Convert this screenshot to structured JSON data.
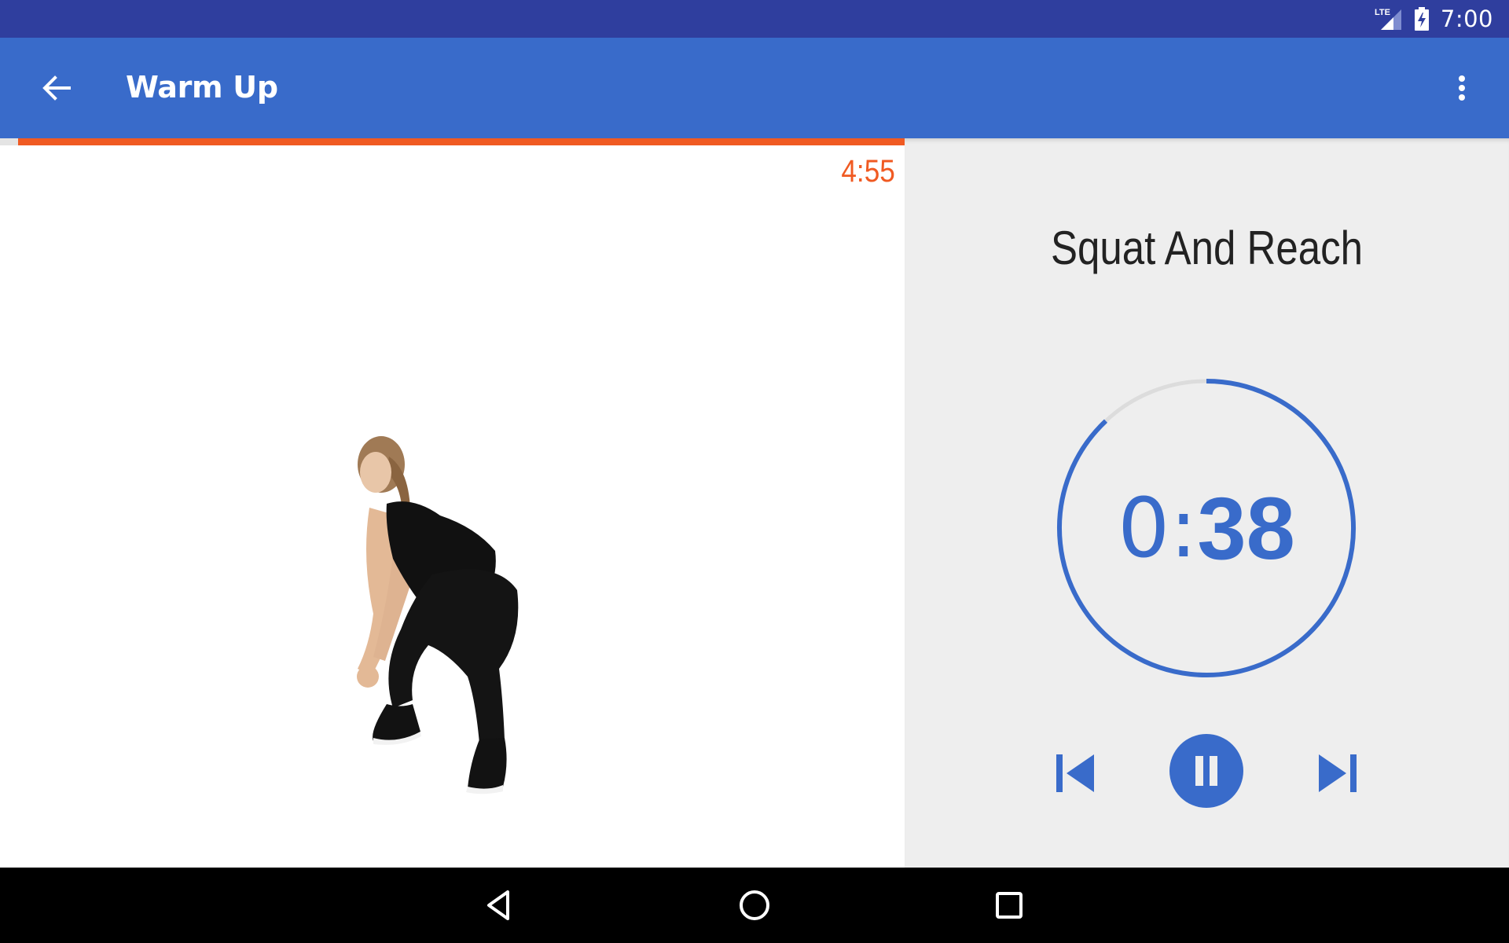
{
  "status_bar": {
    "network": "LTE",
    "time": "7:00",
    "icons": [
      "lte-signal-icon",
      "battery-charging-icon"
    ]
  },
  "app_bar": {
    "title": "Warm Up",
    "back_icon": "arrow-back-icon",
    "overflow_icon": "more-vert-icon"
  },
  "video": {
    "remaining_time": "4:55",
    "workout_progress_remaining_fraction": 0.98,
    "colors": {
      "progress": "#f05a22",
      "track": "#e4e4e4"
    }
  },
  "exercise": {
    "name": "Squat And Reach",
    "timer": {
      "minutes": "0",
      "colon": ":",
      "seconds": "38",
      "remaining_fraction": 0.88
    },
    "colors": {
      "accent": "#396bca",
      "ring_track": "#dcdcdc"
    }
  },
  "controls": {
    "previous_icon": "skip-previous-icon",
    "pause_icon": "pause-icon",
    "next_icon": "skip-next-icon"
  },
  "nav_bar": {
    "back_icon": "nav-back-icon",
    "home_icon": "nav-home-icon",
    "recents_icon": "nav-recents-icon"
  }
}
